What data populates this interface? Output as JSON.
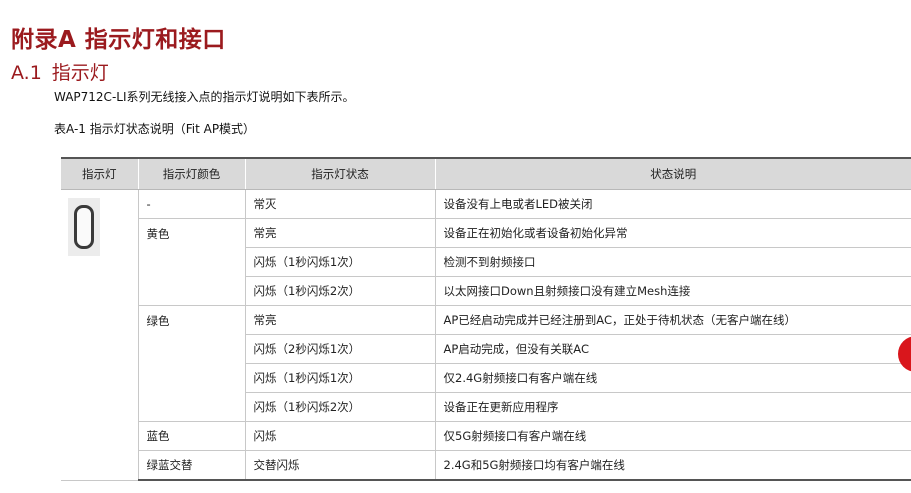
{
  "doc": {
    "appendix_title": "附录A  指示灯和接口",
    "section_number": "A.1",
    "section_title": "指示灯",
    "intro": "WAP712C-LI系列无线接入点的指示灯说明如下表所示。",
    "caption": "表A-1 指示灯状态说明（Fit AP模式）"
  },
  "table": {
    "headers": [
      "指示灯",
      "指示灯颜色",
      "指示灯状态",
      "状态说明"
    ],
    "indicator_icon": "led-capsule-icon",
    "groups": [
      {
        "color": "-",
        "rows": [
          {
            "state": "常灭",
            "desc": "设备没有上电或者LED被关闭"
          }
        ]
      },
      {
        "color": "黄色",
        "rows": [
          {
            "state": "常亮",
            "desc": "设备正在初始化或者设备初始化异常"
          },
          {
            "state": "闪烁（1秒闪烁1次）",
            "desc": "检测不到射频接口"
          },
          {
            "state": "闪烁（1秒闪烁2次）",
            "desc": "以太网接口Down且射频接口没有建立Mesh连接"
          }
        ]
      },
      {
        "color": "绿色",
        "rows": [
          {
            "state": "常亮",
            "desc": "AP已经启动完成并已经注册到AC，正处于待机状态（无客户端在线）"
          },
          {
            "state": "闪烁（2秒闪烁1次）",
            "desc": "AP启动完成，但没有关联AC"
          },
          {
            "state": "闪烁（1秒闪烁1次）",
            "desc": "仅2.4G射频接口有客户端在线"
          },
          {
            "state": "闪烁（1秒闪烁2次）",
            "desc": "设备正在更新应用程序"
          }
        ]
      },
      {
        "color": "蓝色",
        "rows": [
          {
            "state": "闪烁",
            "desc": "仅5G射频接口有客户端在线"
          }
        ]
      },
      {
        "color": "绿蓝交替",
        "rows": [
          {
            "state": "交替闪烁",
            "desc": "2.4G和5G射频接口均有客户端在线"
          }
        ]
      }
    ]
  },
  "colors": {
    "heading": "#9b1a1e",
    "header_bg": "#d9d9d9",
    "badge": "#d9161c"
  }
}
